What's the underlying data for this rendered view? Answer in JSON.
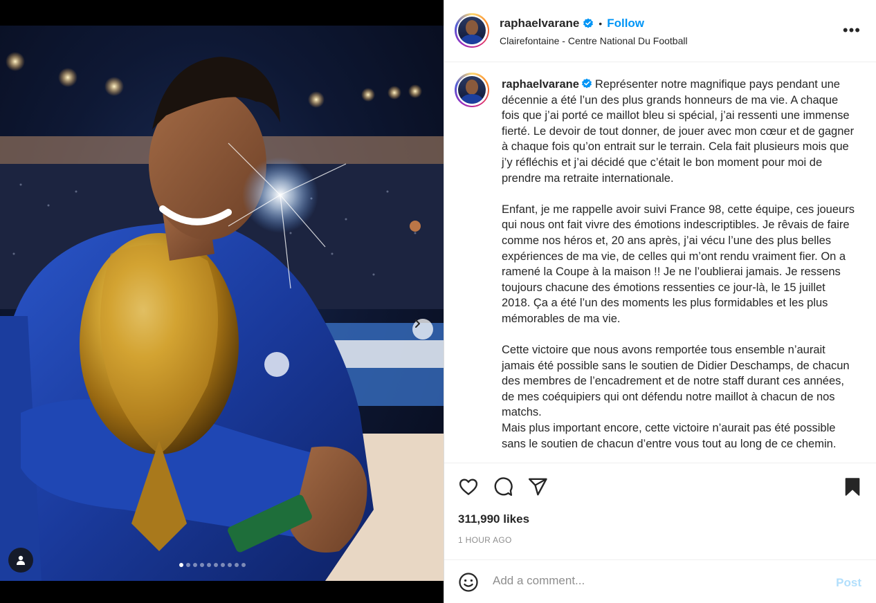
{
  "colors": {
    "accent": "#0095f6",
    "post_disabled": "#b2dffc",
    "text": "#262626",
    "muted": "#8e8e8e"
  },
  "media": {
    "carousel_count": 10,
    "active_index": 0,
    "next_icon": "chevron-right-icon",
    "tag_icon": "user-tag-icon"
  },
  "post": {
    "username": "raphaelvarane",
    "verified_icon": "verified-badge-icon",
    "separator": "•",
    "follow_label": "Follow",
    "location": "Clairefontaine - Centre National Du Football",
    "more_label": "•••",
    "caption_first": "Représenter notre magnifique pays pendant une décennie a été l’un des plus grands honneurs de ma vie. A chaque fois que j’ai porté ce maillot bleu si spécial, j’ai ressenti une immense fierté. Le devoir de tout donner, de jouer avec mon cœur et de gagner à chaque fois qu’on entrait sur le terrain. Cela fait plusieurs mois que j’y réfléchis et j’ai décidé que c’était le bon moment pour moi de prendre ma retraite internationale.",
    "caption_second": "Enfant, je me rappelle avoir suivi France 98, cette équipe, ces joueurs qui nous ont fait vivre des émotions indescriptibles. Je rêvais de faire comme nos héros et, 20 ans après, j’ai vécu l’une des plus belles expériences de ma vie, de celles qui m’ont rendu vraiment fier. On a ramené la Coupe à la maison !! Je ne l’oublierai jamais. Je ressens toujours chacune des émotions ressenties ce jour-là, le 15 juillet 2018. Ça a été l’un des moments les plus formidables et les plus mémorables de ma vie.",
    "caption_third": "Cette victoire que nous avons remportée tous ensemble n’aurait jamais été possible sans le soutien de Didier Deschamps, de chacun des membres de l’encadrement et de notre staff durant ces années, de mes coéquipiers qui ont défendu notre maillot à chacun de nos matchs.",
    "caption_fourth": "Mais plus important encore, cette victoire n’aurait pas été possible sans le soutien de chacun d’entre vous tout au long de ce chemin.",
    "likes": "311,990 likes",
    "time": "1 HOUR AGO"
  },
  "actions": {
    "like_icon": "heart-icon",
    "comment_icon": "comment-icon",
    "share_icon": "send-icon",
    "save_icon": "bookmark-icon"
  },
  "comment": {
    "emoji_icon": "emoji-icon",
    "placeholder": "Add a comment...",
    "post_label": "Post"
  }
}
